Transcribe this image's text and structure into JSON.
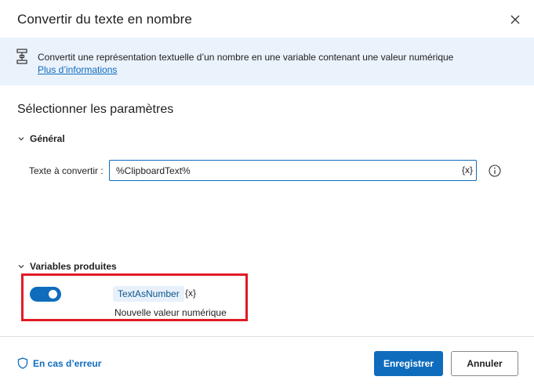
{
  "dialog": {
    "title": "Convertir du texte en nombre"
  },
  "info": {
    "text": "Convertit une représentation textuelle d’un nombre en une variable contenant une valeur numérique",
    "link": "Plus d’informations"
  },
  "section": {
    "title": "Sélectionner les paramètres"
  },
  "general": {
    "header": "Général",
    "text_to_convert_label": "Texte à convertir :",
    "text_to_convert_value": "%ClipboardText%",
    "var_button": "{x}"
  },
  "variables": {
    "header": "Variables produites",
    "toggle_on": true,
    "var_name": "TextAsNumber",
    "var_button": "{x}",
    "var_description": "Nouvelle valeur numérique"
  },
  "footer": {
    "error_link": "En cas d’erreur",
    "save_label": "Enregistrer",
    "cancel_label": "Annuler"
  },
  "colors": {
    "accent": "#0f6cbd",
    "banner_bg": "#eaf2fc",
    "highlight": "#e01b24"
  },
  "icons": {
    "close": "close-icon",
    "info": "action-flow-icon",
    "chevron": "chevron-down-icon",
    "help": "info-circle-icon",
    "shield": "shield-icon"
  }
}
